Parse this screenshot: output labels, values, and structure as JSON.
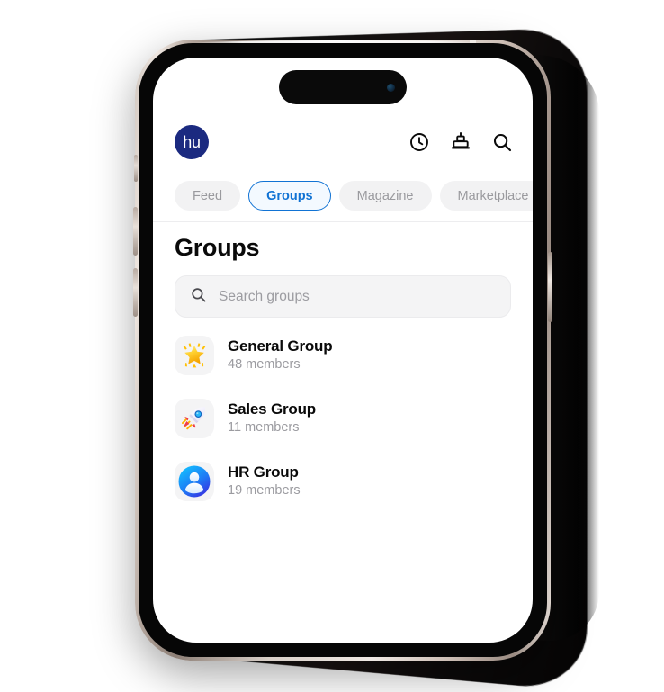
{
  "app": {
    "brand_mark": "hu",
    "brand_color": "#1b2a80"
  },
  "header": {
    "icons": [
      {
        "name": "clock-icon",
        "label": "Recent"
      },
      {
        "name": "cake-icon",
        "label": "Birthdays"
      },
      {
        "name": "search-icon",
        "label": "Search"
      }
    ]
  },
  "tabs": {
    "active": "Groups",
    "items": [
      {
        "label": "Feed",
        "active": false
      },
      {
        "label": "Groups",
        "active": true
      },
      {
        "label": "Magazine",
        "active": false
      },
      {
        "label": "Marketplace",
        "active": false
      }
    ]
  },
  "main": {
    "title": "Groups",
    "search": {
      "value": "",
      "placeholder": "Search groups"
    },
    "groups": [
      {
        "name": "General Group",
        "members": "48 members",
        "icon": "glowing-star-icon"
      },
      {
        "name": "Sales Group",
        "members": "11 members",
        "icon": "rocket-icon"
      },
      {
        "name": "HR Group",
        "members": "19 members",
        "icon": "person-avatar-icon"
      }
    ]
  },
  "colors": {
    "accent": "#1173d4",
    "tab_inactive_bg": "#f2f2f3",
    "tab_inactive_text": "#9a9a9e",
    "muted_text": "#9b9ba0",
    "surface": "#f4f4f5"
  }
}
